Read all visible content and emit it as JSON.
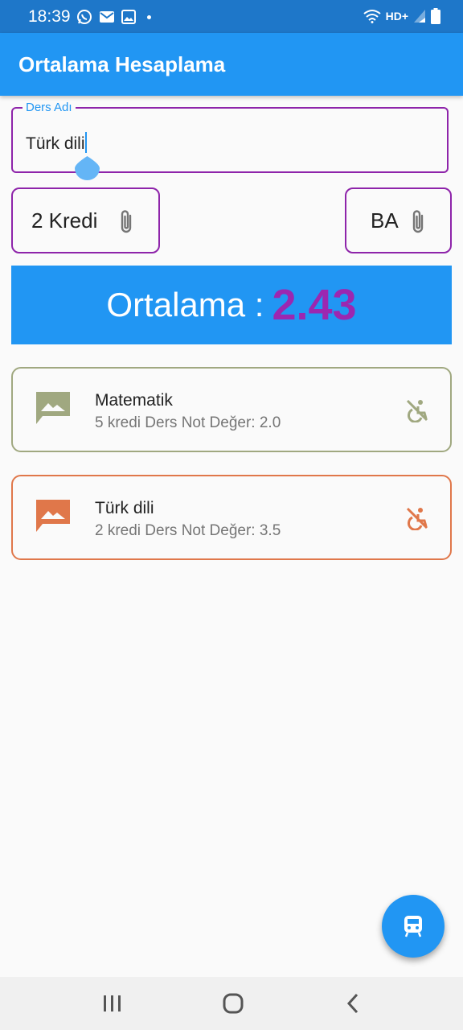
{
  "status_bar": {
    "time": "18:39",
    "network": "HD+"
  },
  "app_bar": {
    "title": "Ortalama Hesaplama"
  },
  "form": {
    "ders_adi_label": "Ders Adı",
    "ders_adi_value": "Türk dili",
    "kredi_selected": "2 Kredi",
    "not_selected": "BA"
  },
  "average": {
    "label": "Ortalama : ",
    "value": "2.43"
  },
  "courses": [
    {
      "name": "Matematik",
      "detail": "5 kredi Ders Not Değer: 2.0",
      "color": "#a0a880"
    },
    {
      "name": "Türk dili",
      "detail": "2 kredi Ders Not Değer: 3.5",
      "color": "#e0774a"
    }
  ],
  "colors": {
    "primary": "#2196f3",
    "accent": "#9c27b0",
    "status_bar": "#1e77c9"
  },
  "icons": {
    "course_leading": "image-icon",
    "course_trailing": "accessible-off-icon",
    "fab": "train-icon",
    "select_trailing": "paperclip-icon"
  }
}
